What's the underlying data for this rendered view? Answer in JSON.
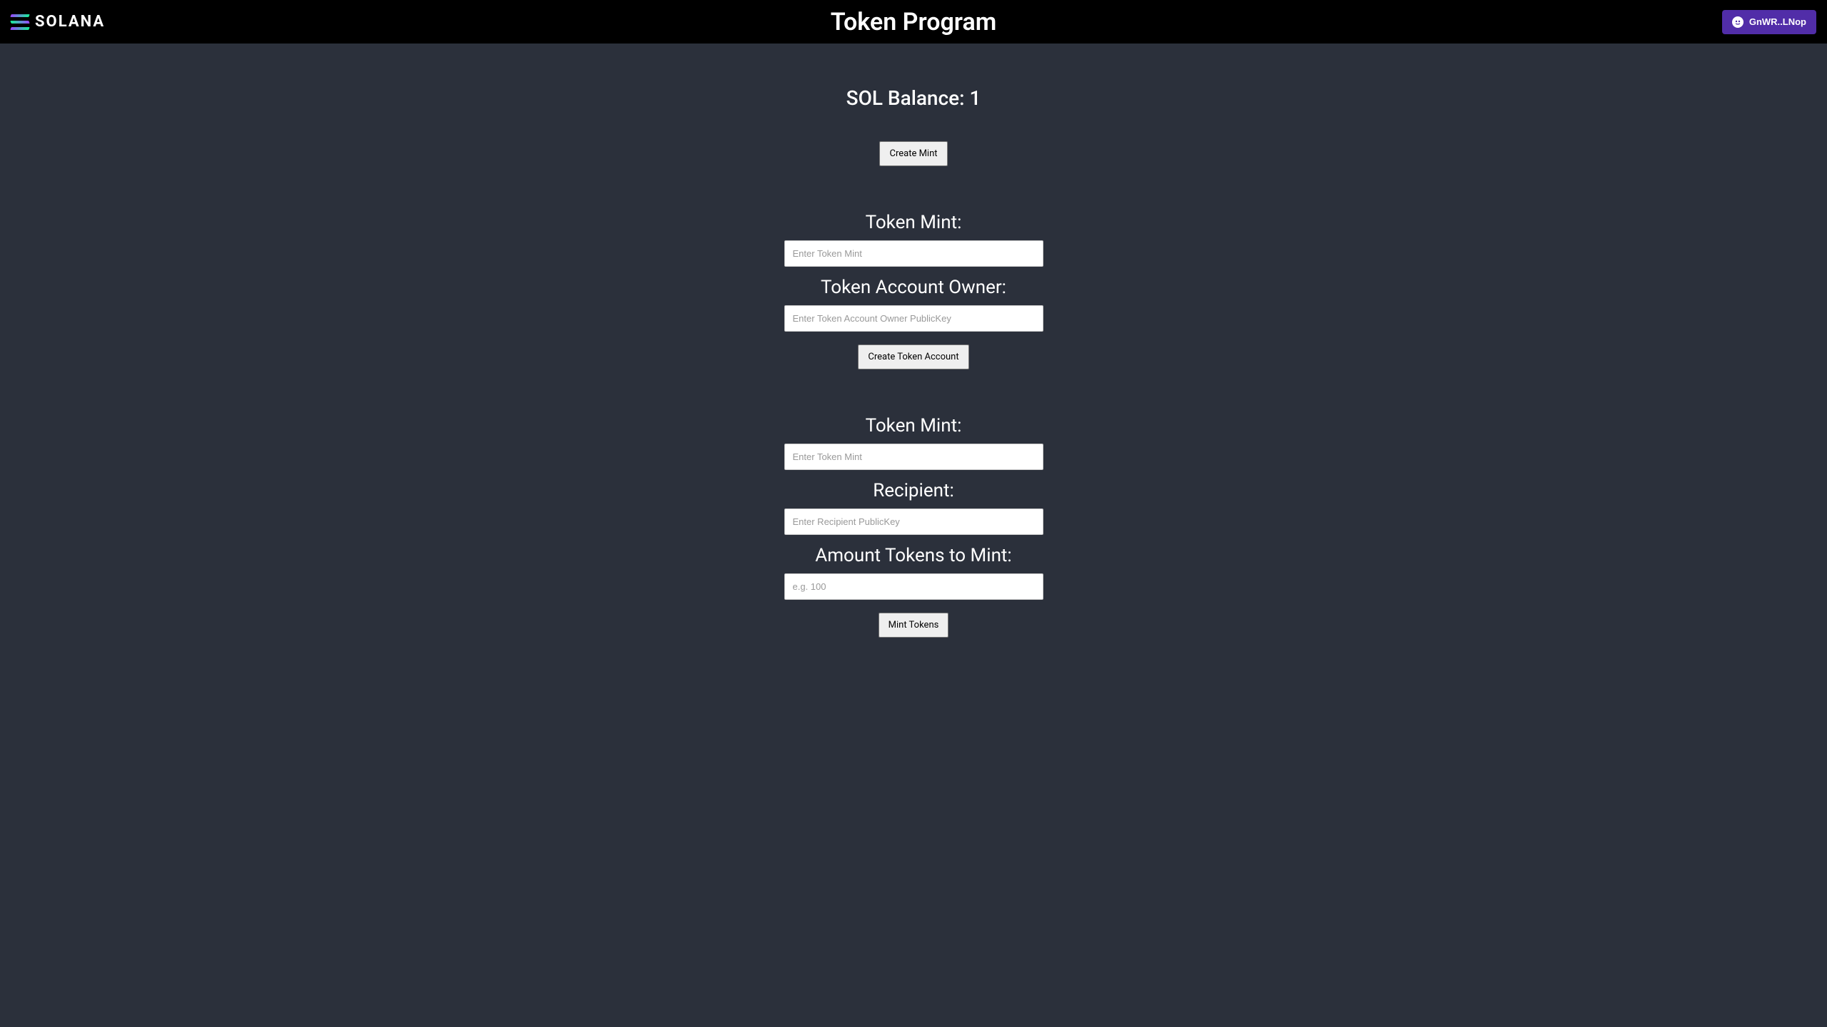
{
  "header": {
    "logo_text": "SOLANA",
    "page_title": "Token Program",
    "wallet_label": "GnWR..LNop"
  },
  "balance": {
    "label": "SOL Balance: 1"
  },
  "create_mint": {
    "button_label": "Create Mint"
  },
  "create_account": {
    "token_mint_label": "Token Mint:",
    "token_mint_placeholder": "Enter Token Mint",
    "owner_label": "Token Account Owner:",
    "owner_placeholder": "Enter Token Account Owner PublicKey",
    "button_label": "Create Token Account"
  },
  "mint_tokens": {
    "token_mint_label": "Token Mint:",
    "token_mint_placeholder": "Enter Token Mint",
    "recipient_label": "Recipient:",
    "recipient_placeholder": "Enter Recipient PublicKey",
    "amount_label": "Amount Tokens to Mint:",
    "amount_placeholder": "e.g. 100",
    "button_label": "Mint Tokens"
  }
}
